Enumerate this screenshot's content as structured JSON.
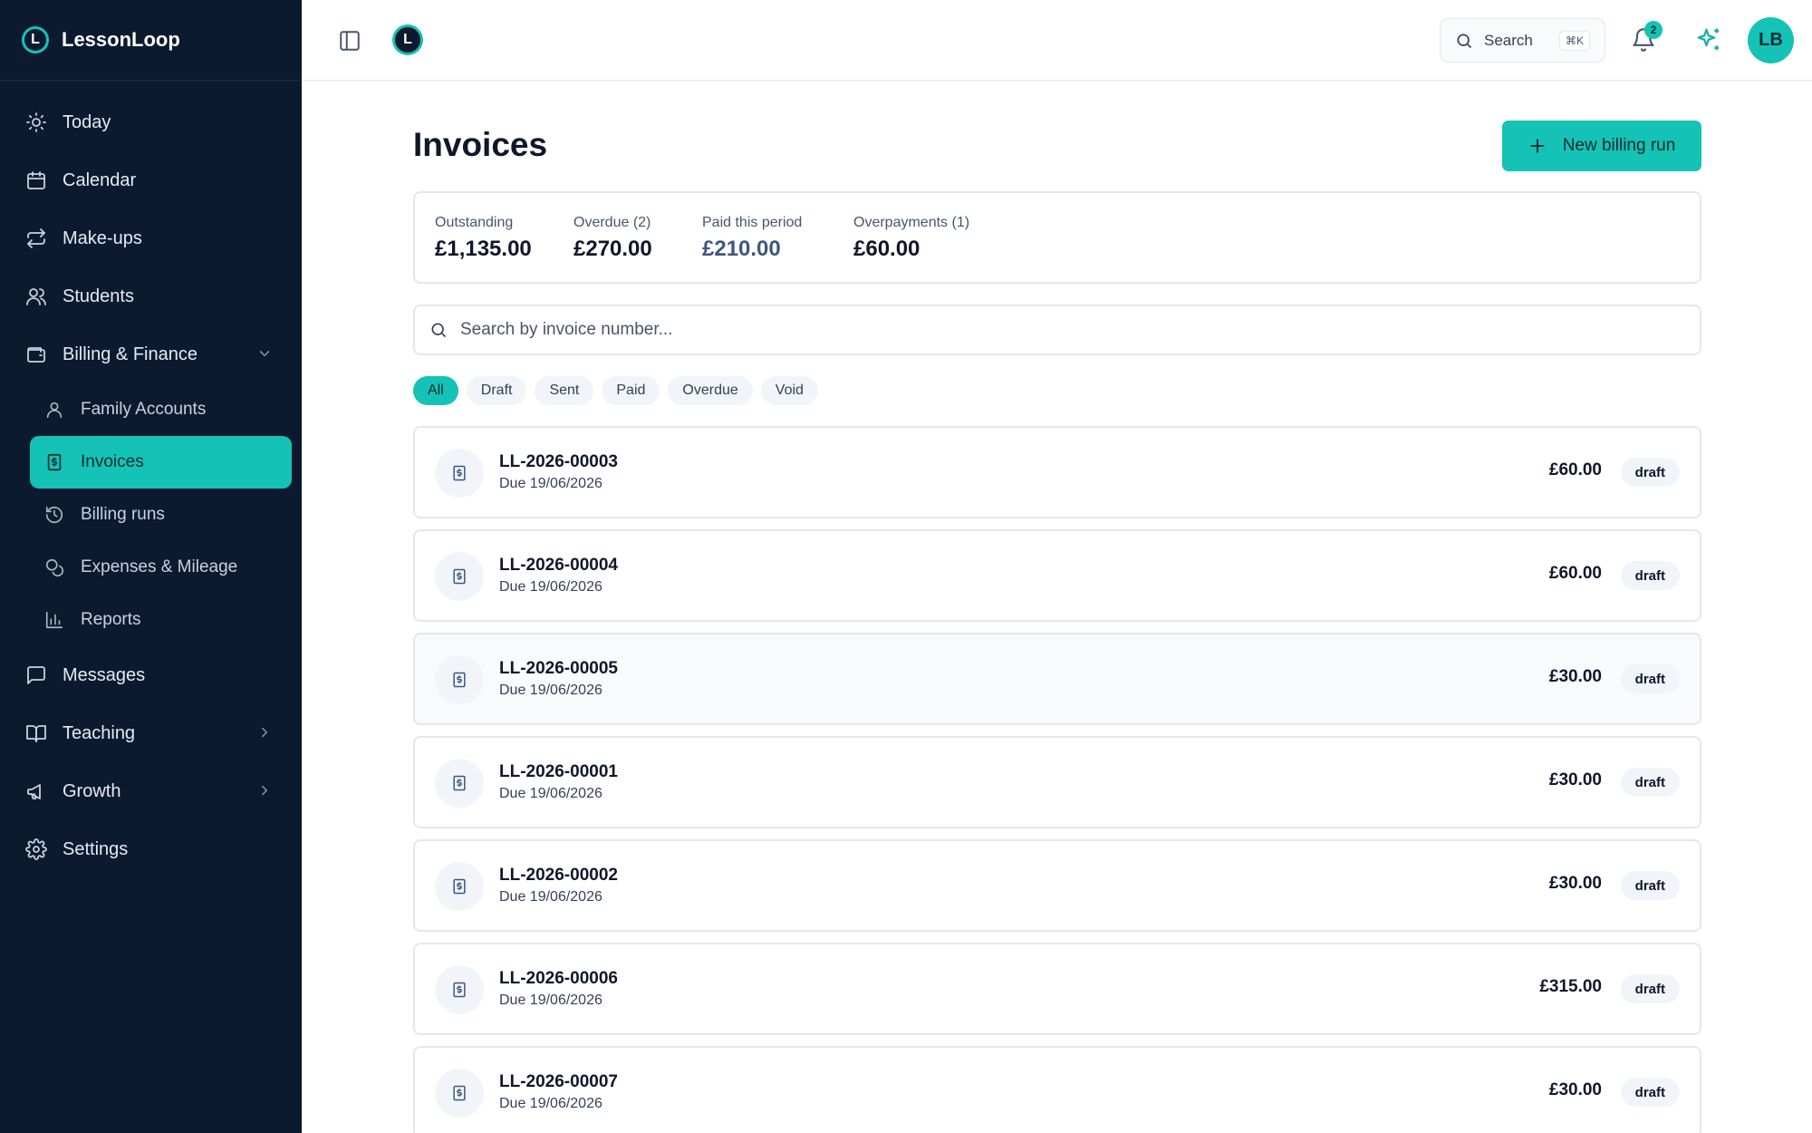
{
  "app": {
    "name": "LessonLoop",
    "logo_letter": "L"
  },
  "sidebar": {
    "items": [
      {
        "label": "Today",
        "icon": "sun-icon"
      },
      {
        "label": "Calendar",
        "icon": "calendar-icon"
      },
      {
        "label": "Make-ups",
        "icon": "repeat-icon"
      },
      {
        "label": "Students",
        "icon": "users-icon"
      },
      {
        "label": "Billing & Finance",
        "icon": "wallet-icon",
        "expanded": true
      },
      {
        "label": "Messages",
        "icon": "message-icon"
      },
      {
        "label": "Teaching",
        "icon": "book-icon"
      },
      {
        "label": "Growth",
        "icon": "megaphone-icon"
      },
      {
        "label": "Settings",
        "icon": "gear-icon"
      }
    ],
    "billing_sub": [
      {
        "label": "Family Accounts",
        "icon": "user-icon"
      },
      {
        "label": "Invoices",
        "icon": "invoice-icon",
        "active": true
      },
      {
        "label": "Billing runs",
        "icon": "history-icon"
      },
      {
        "label": "Expenses & Mileage",
        "icon": "coins-icon"
      },
      {
        "label": "Reports",
        "icon": "bar-chart-icon"
      }
    ]
  },
  "topbar": {
    "search_label": "Search",
    "search_shortcut": "⌘K",
    "notification_count": "2",
    "avatar_initials": "LB"
  },
  "page": {
    "title": "Invoices",
    "new_button": "New billing run",
    "stats": [
      {
        "label": "Outstanding",
        "value": "£1,135.00"
      },
      {
        "label": "Overdue (2)",
        "value": "£270.00"
      },
      {
        "label": "Paid this period",
        "value": "£210.00"
      },
      {
        "label": "Overpayments (1)",
        "value": "£60.00"
      }
    ],
    "search_placeholder": "Search by invoice number...",
    "filters": [
      "All",
      "Draft",
      "Sent",
      "Paid",
      "Overdue",
      "Void"
    ],
    "active_filter": "All",
    "invoices": [
      {
        "number": "LL-2026-00003",
        "due": "Due 19/06/2026",
        "amount": "£60.00",
        "status": "draft"
      },
      {
        "number": "LL-2026-00004",
        "due": "Due 19/06/2026",
        "amount": "£60.00",
        "status": "draft"
      },
      {
        "number": "LL-2026-00005",
        "due": "Due 19/06/2026",
        "amount": "£30.00",
        "status": "draft"
      },
      {
        "number": "LL-2026-00001",
        "due": "Due 19/06/2026",
        "amount": "£30.00",
        "status": "draft"
      },
      {
        "number": "LL-2026-00002",
        "due": "Due 19/06/2026",
        "amount": "£30.00",
        "status": "draft"
      },
      {
        "number": "LL-2026-00006",
        "due": "Due 19/06/2026",
        "amount": "£315.00",
        "status": "draft"
      },
      {
        "number": "LL-2026-00007",
        "due": "Due 19/06/2026",
        "amount": "£30.00",
        "status": "draft"
      }
    ]
  },
  "colors": {
    "sidebar_bg": "#0c1a30",
    "accent": "#14c3b5",
    "text": "#0f172a",
    "muted_value": "#3f5680"
  }
}
